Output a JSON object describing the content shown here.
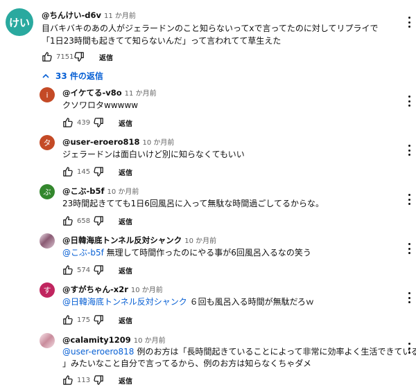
{
  "main_comment": {
    "avatar_text": "けい",
    "avatar_color": "#2aa99f",
    "author": "@ちんけい-d6v",
    "time": "11 か月前",
    "text_line1": "目バキバキのあの人がジェラードンのこと知らないってxで言ってたのに対してリプライで",
    "text_line2": "「1日23時間も起きてて知らないんだ」って言われてて草生えた",
    "likes": "7151",
    "reply_label": "返信"
  },
  "replies_toggle": {
    "label": "33 件の返信"
  },
  "replies": [
    {
      "avatar_text": "i",
      "avatar_color": "#c44a26",
      "author": "@イケてる-v8o",
      "time": "11 か月前",
      "text": "クソワロタwwwww",
      "likes": "439",
      "reply_label": "返信"
    },
    {
      "avatar_text": "タ",
      "avatar_color": "#c44a26",
      "author": "@user-eroero818",
      "time": "10 か月前",
      "text": "ジェラードンは面白いけど別に知らなくてもいい",
      "likes": "145",
      "reply_label": "返信"
    },
    {
      "avatar_text": "ぶ",
      "avatar_color": "#33872d",
      "author": "@こぶ-b5f",
      "time": "10 か月前",
      "text": "23時間起きてても1日6回風呂に入って無駄な時間過ごしてるからな。",
      "likes": "658",
      "reply_label": "返信"
    },
    {
      "author": "@日韓海底トンネル反対シャンク",
      "time": "10 か月前",
      "mention": "@こぶ-b5f",
      "text": " 無理して時間作ったのにやる事が6回風呂入るなの笑う",
      "likes": "574",
      "reply_label": "返信"
    },
    {
      "avatar_text": "す",
      "avatar_color": "#c0255f",
      "author": "@すがちゃん-x2r",
      "time": "10 か月前",
      "mention": "@日韓海底トンネル反対シャンク",
      "text": " ６回も風呂入る時間が無駄だろｗ",
      "likes": "175",
      "reply_label": "返信"
    },
    {
      "author": "@calamity1209",
      "time": "10 か月前",
      "text_line1": "例のお方は「長時間起きていることによって非常に効率よく生活できている",
      "mention": "@user-eroero818",
      "text_line2": "」みたいなこと自分で言ってるから、例のお方は知らなくちゃダメ",
      "likes": "113",
      "reply_label": "返信"
    }
  ]
}
